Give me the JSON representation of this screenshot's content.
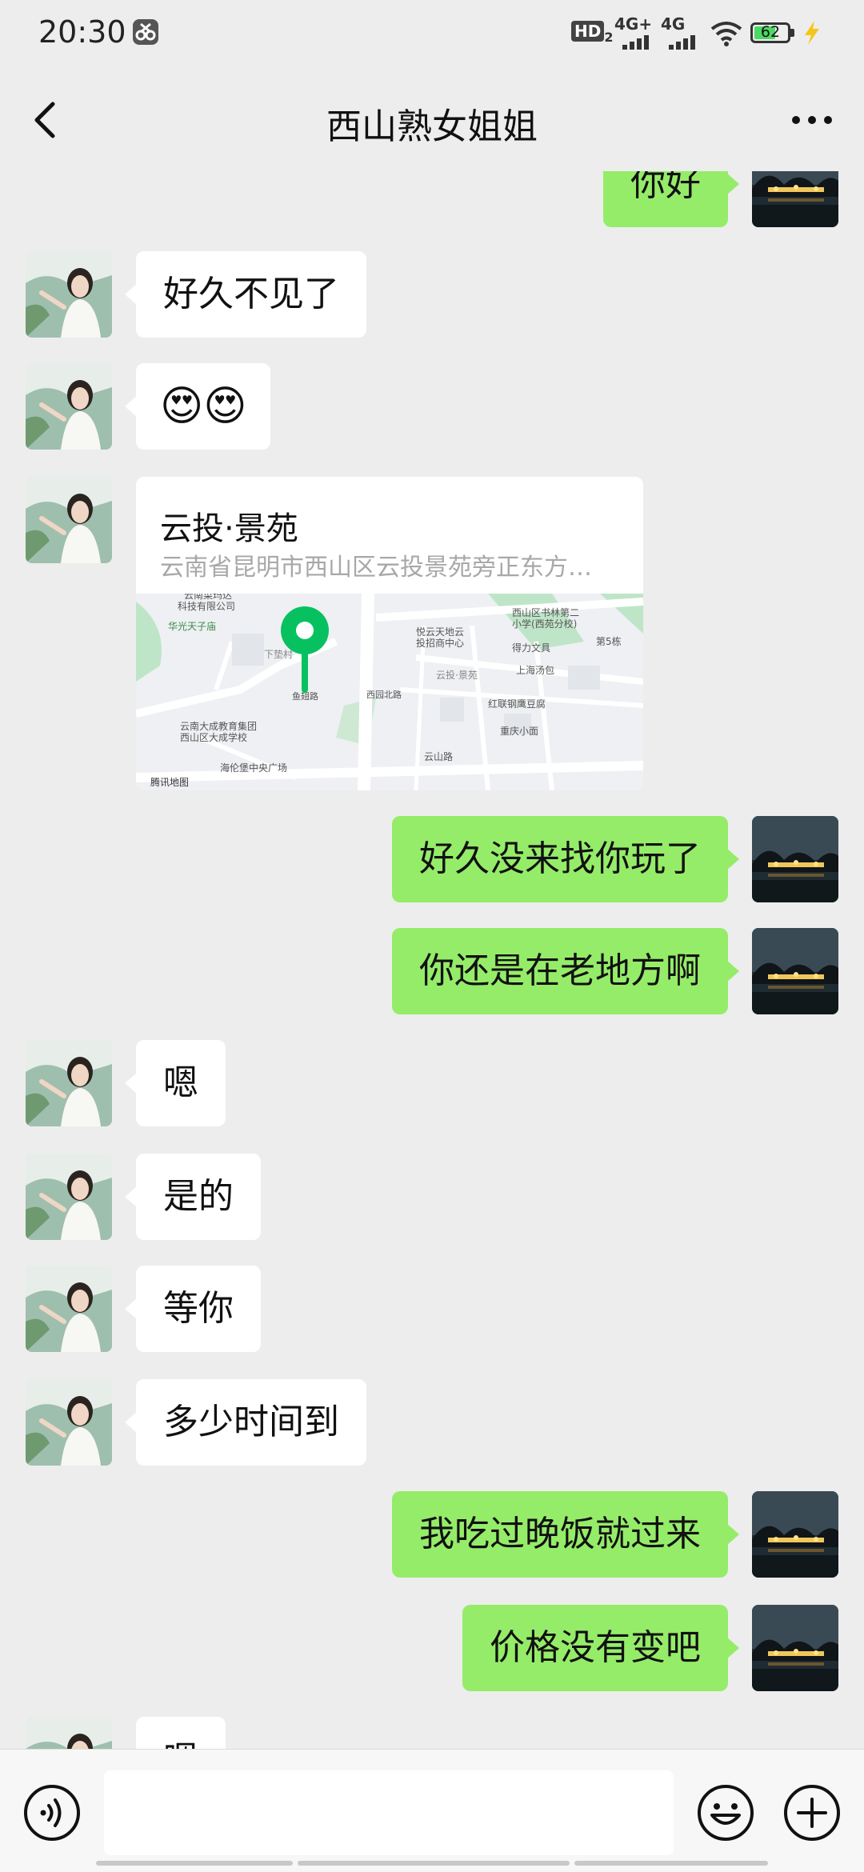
{
  "status_bar": {
    "time": "20:30",
    "hd_label": "HD",
    "sim2_label": "2",
    "net1": "4G+",
    "net2": "4G",
    "battery": "62"
  },
  "header": {
    "title": "西山熟女姐姐"
  },
  "messages": [
    {
      "side": "right",
      "type": "text",
      "text": "你好"
    },
    {
      "side": "left",
      "type": "text",
      "text": "好久不见了"
    },
    {
      "side": "left",
      "type": "emoji",
      "text": "😍😍"
    },
    {
      "side": "left",
      "type": "location",
      "title": "云投·景苑",
      "address": "云南省昆明市西山区云投景苑旁正东方…"
    },
    {
      "side": "right",
      "type": "text",
      "text": "好久没来找你玩了"
    },
    {
      "side": "right",
      "type": "text",
      "text": "你还是在老地方啊"
    },
    {
      "side": "left",
      "type": "text",
      "text": "嗯"
    },
    {
      "side": "left",
      "type": "text",
      "text": "是的"
    },
    {
      "side": "left",
      "type": "text",
      "text": "等你"
    },
    {
      "side": "left",
      "type": "text",
      "text": "多少时间到"
    },
    {
      "side": "right",
      "type": "text",
      "text": "我吃过晚饭就过来"
    },
    {
      "side": "right",
      "type": "text",
      "text": "价格没有变吧"
    },
    {
      "side": "left",
      "type": "text",
      "text": "嗯"
    }
  ],
  "map": {
    "watermark": "腾讯地图",
    "labels": [
      "云南菜玛达",
      "科技有限公司",
      "华光天子庙",
      "下垫村",
      "云南大成教育集团",
      "西山区大成学校",
      "海伦堡中央广场",
      "悦云天地云",
      "投招商中心",
      "西山区书林第二",
      "小学(西苑分校)",
      "得力文具",
      "上海汤包",
      "红联钢鹰豆腐",
      "重庆小面",
      "云山路",
      "云投·景苑",
      "第5栋",
      "西园北路",
      "鱼翅路"
    ]
  },
  "input_bar": {
    "icons": [
      "voice-icon",
      "emoji-icon",
      "plus-icon"
    ]
  }
}
